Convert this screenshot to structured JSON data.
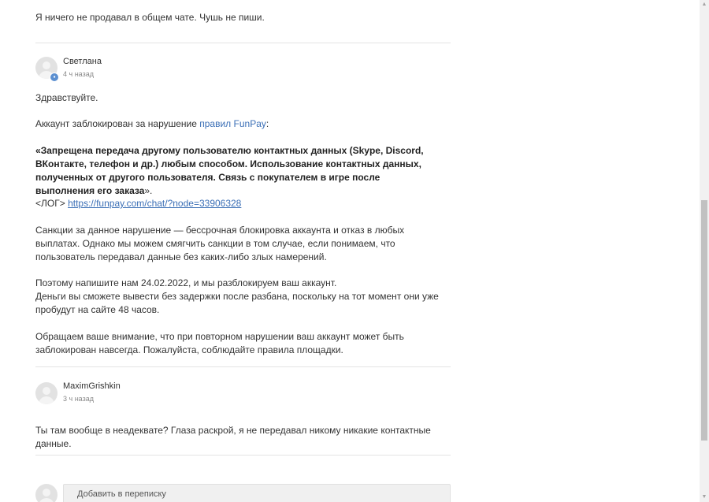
{
  "prev_message": {
    "text": "Я ничего не продавал в общем чате. Чушь не пиши."
  },
  "messages": [
    {
      "author": "Светлана",
      "time": "4 ч назад",
      "greeting": "Здравствуйте.",
      "blocked_prefix": "Аккаунт заблокирован за нарушение ",
      "rules_link": "правил FunPay",
      "blocked_suffix": ":",
      "rule_open": "«",
      "rule_text": "Запрещена передача другому пользователю контактных данных (Skype, Discord, ВКонтакте, телефон и др.) любым способом. Использование контактных данных, полученных от другого пользователя. Связь с покупателем в игре после выполнения его заказа",
      "rule_close": "».",
      "log_label": "<ЛОГ>",
      "log_link": "https://funpay.com/chat/?node=33906328",
      "sanctions": "Санкции за данное нарушение — бессрочная блокировка аккаунта и отказ в любых выплатах. Однако мы можем смягчить санкции в том случае, если понимаем, что пользователь передавал данные без каких-либо злых намерений.",
      "unblock_line1": "Поэтому напишите нам 24.02.2022, и мы разблокируем ваш аккаунт.",
      "unblock_line2": "Деньги вы сможете вывести без задержки после разбана, поскольку на тот момент они уже пробудут на сайте 48 часов.",
      "warning": "Обращаем ваше внимание, что при повторном нарушении ваш аккаунт может быть заблокирован навсегда. Пожалуйста, соблюдайте правила площадки."
    },
    {
      "author": "MaximGrishkin",
      "time": "3 ч назад",
      "text": "Ты там вообще в неадеквате? Глаза раскрой, я не передавал никому никакие контактные данные."
    }
  ],
  "reply": {
    "placeholder": "Добавить в переписку"
  },
  "icons": {
    "avatar": "user-avatar-icon",
    "badge": "support-badge-icon"
  },
  "colors": {
    "link": "#3b6fb6",
    "badge": "#5b8fd0"
  }
}
